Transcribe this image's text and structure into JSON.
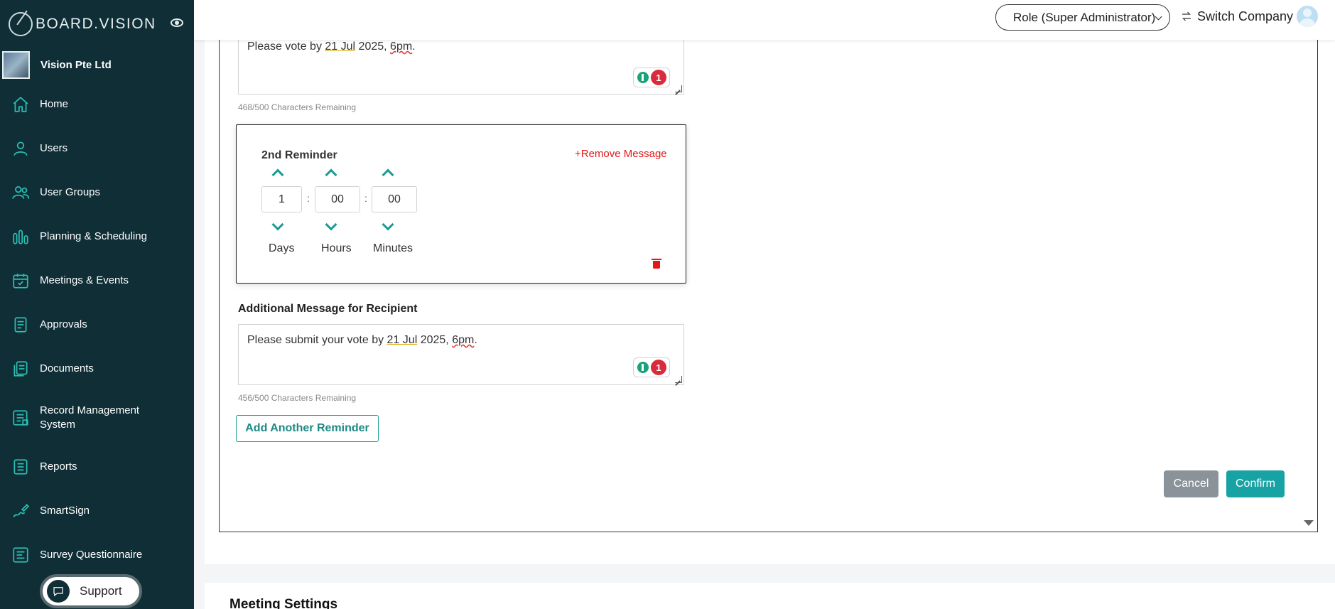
{
  "brand": {
    "name": "BOARD.VISION"
  },
  "company": {
    "name": "Vision Pte Ltd"
  },
  "sidebar": {
    "items": [
      {
        "label": "Home",
        "icon": "home-icon"
      },
      {
        "label": "Users",
        "icon": "user-icon"
      },
      {
        "label": "User Groups",
        "icon": "users-icon"
      },
      {
        "label": "Planning & Scheduling",
        "icon": "bar-chart-icon"
      },
      {
        "label": "Meetings & Events",
        "icon": "calendar-icon"
      },
      {
        "label": "Approvals",
        "icon": "document-check-icon"
      },
      {
        "label": "Documents",
        "icon": "documents-icon"
      },
      {
        "label": "Record Management System",
        "icon": "record-icon"
      },
      {
        "label": "Reports",
        "icon": "report-icon"
      },
      {
        "label": "SmartSign",
        "icon": "signature-icon"
      },
      {
        "label": "Survey Questionnaire",
        "icon": "survey-icon"
      }
    ],
    "support_label": "Support"
  },
  "topbar": {
    "role": "Role (Super Administrator)",
    "switch_company": "Switch Company"
  },
  "first_message": {
    "text_before": "Please vote by ",
    "date": "21 Jul",
    "year_sep": " 2025, ",
    "time": "6pm",
    "text_after": ".",
    "grammar_count": "1",
    "chars_remaining": "468/500 Characters Remaining"
  },
  "reminder": {
    "title": "2nd Reminder",
    "remove_label": "+Remove Message",
    "days": "1",
    "hours": "00",
    "minutes": "00",
    "days_label": "Days",
    "hours_label": "Hours",
    "minutes_label": "Minutes",
    "separator": ":"
  },
  "additional_message": {
    "label": "Additional Message for Recipient",
    "text_before": "Please submit your vote by ",
    "date": "21 Jul",
    "year_sep": " 2025, ",
    "time": "6pm",
    "text_after": ".",
    "grammar_count": "1",
    "chars_remaining": "456/500 Characters Remaining"
  },
  "actions": {
    "add_reminder": "Add Another Reminder",
    "cancel": "Cancel",
    "confirm": "Confirm"
  },
  "meeting_settings": {
    "title": "Meeting Settings"
  },
  "colors": {
    "sidebar_bg": "#0f2e36",
    "accent_teal": "#17a2a4",
    "danger_red": "#e01919",
    "cancel_gray": "#8a9399"
  }
}
